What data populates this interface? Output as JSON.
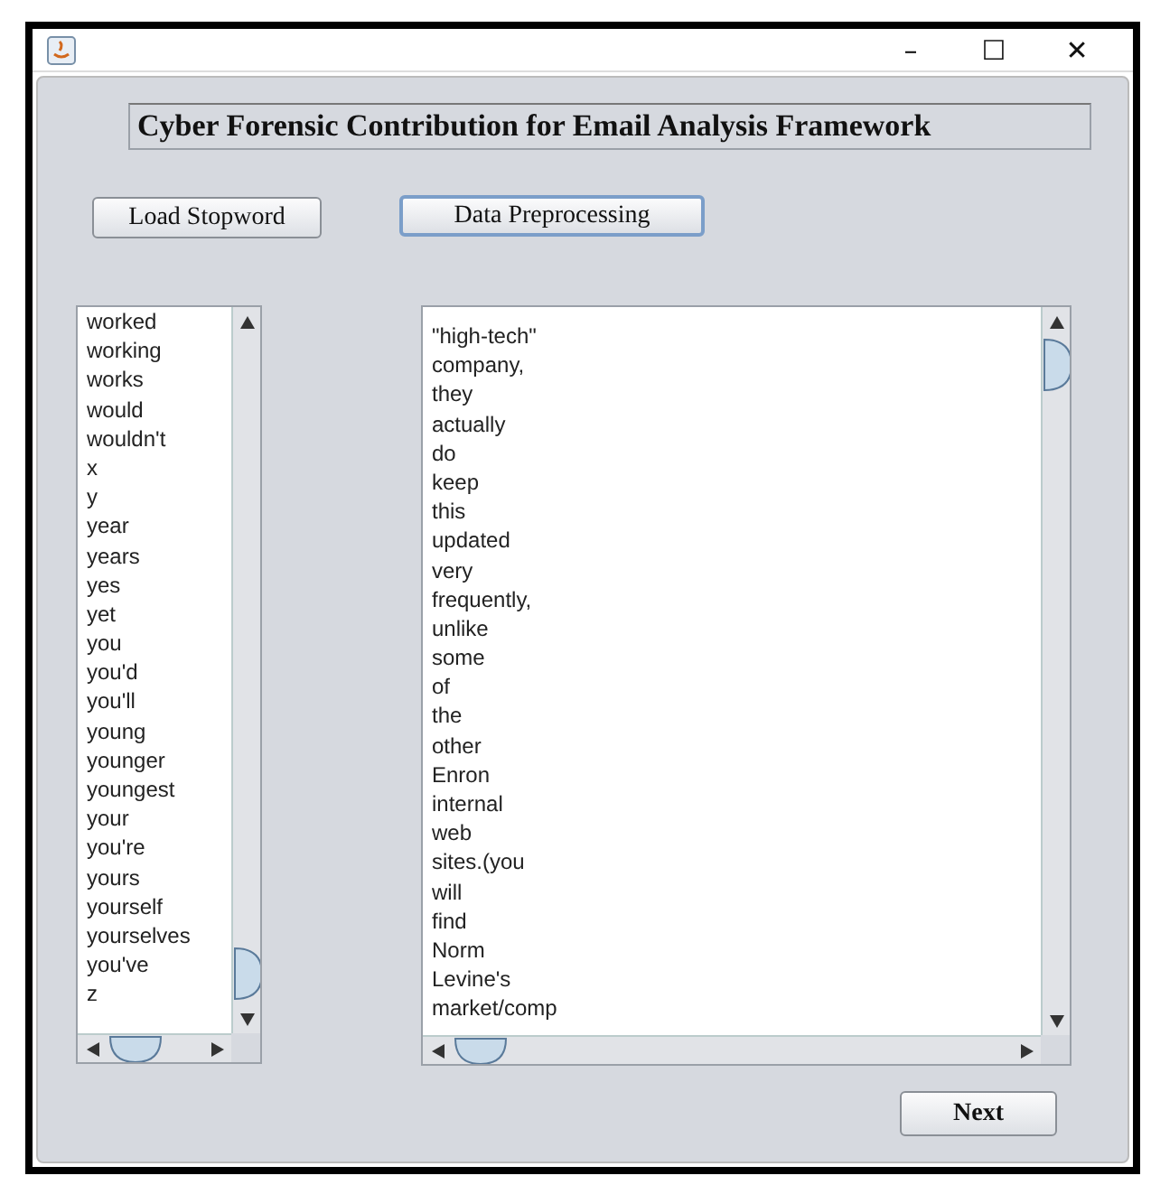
{
  "window": {
    "title_bar_buttons": [
      "–",
      "☐",
      "✕"
    ]
  },
  "heading": "Cyber Forensic Contribution for Email Analysis Framework",
  "buttons": [
    {
      "label": "Load Stopword",
      "focused": false
    },
    {
      "label": "Data Preprocessing",
      "focused": true
    }
  ],
  "stopword_list": [
    "worked",
    "working",
    "works",
    "would",
    "wouldn't",
    "x",
    "y",
    "year",
    "years",
    "yes",
    "yet",
    "you",
    "you'd",
    "you'll",
    "young",
    "younger",
    "youngest",
    "your",
    "you're",
    "yours",
    "yourself",
    "yourselves",
    "you've",
    "z"
  ],
  "token_list": [
    "\"high-tech\"",
    "company,",
    "they",
    "actually",
    "do",
    "keep",
    "this",
    "updated",
    "very",
    "frequently,",
    "unlike",
    "some",
    "of",
    "the",
    "other",
    "Enron",
    "internal",
    "web",
    "sites.(you",
    "will",
    "find",
    "Norm",
    "Levine's",
    "market/comp"
  ],
  "next_button": "Next"
}
